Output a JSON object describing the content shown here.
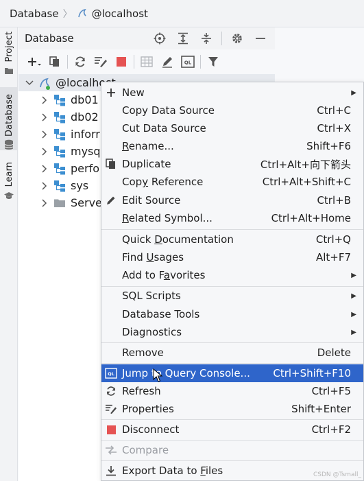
{
  "breadcrumb": {
    "root": "Database",
    "host": "@localhost"
  },
  "strip": {
    "project": "Project",
    "database": "Database",
    "learn": "Learn"
  },
  "tool_window": {
    "title": "Database"
  },
  "tree": {
    "root": {
      "label": "@localhost"
    },
    "items": [
      {
        "label": "db01",
        "kind": "schema"
      },
      {
        "label": "db02",
        "kind": "schema"
      },
      {
        "label": "inforr",
        "kind": "schema"
      },
      {
        "label": "mysq",
        "kind": "schema"
      },
      {
        "label": "perfo",
        "kind": "schema"
      },
      {
        "label": "sys",
        "kind": "schema"
      },
      {
        "label": "Serve",
        "kind": "folder"
      }
    ]
  },
  "menu": {
    "new": {
      "label": "New"
    },
    "copy_source": {
      "label": "Copy Data Source",
      "shortcut": "Ctrl+C"
    },
    "cut_source": {
      "label": "Cut Data Source",
      "shortcut": "Ctrl+X"
    },
    "rename": {
      "label_u": "R",
      "label": "ename...",
      "shortcut": "Shift+F6"
    },
    "duplicate": {
      "label": "Duplicate",
      "shortcut": "Ctrl+Alt+向下箭头"
    },
    "copy_reference": {
      "label_a": "Cop",
      "label_u": "y",
      "label_b": " Reference",
      "shortcut": "Ctrl+Alt+Shift+C"
    },
    "edit_source": {
      "label": "Edit Source",
      "shortcut": "Ctrl+B"
    },
    "related_symbol": {
      "label_u": "R",
      "label": "elated Symbol...",
      "shortcut": "Ctrl+Alt+Home"
    },
    "quick_doc": {
      "label_a": "Quick ",
      "label_u": "D",
      "label_b": "ocumentation",
      "shortcut": "Ctrl+Q"
    },
    "find_usages": {
      "label_a": "Find ",
      "label_u": "U",
      "label_b": "sages",
      "shortcut": "Alt+F7"
    },
    "add_favorites": {
      "label_a": "Add to F",
      "label_u": "a",
      "label_b": "vorites"
    },
    "sql_scripts": {
      "label": "SQL Scripts"
    },
    "database_tools": {
      "label": "Database Tools"
    },
    "diagnostics": {
      "label": "Diagnostics"
    },
    "remove": {
      "label": "Remove",
      "shortcut": "Delete"
    },
    "jump_console": {
      "label": "Jump to Query Console...",
      "shortcut": "Ctrl+Shift+F10"
    },
    "refresh": {
      "label": "Refresh",
      "shortcut": "Ctrl+F5"
    },
    "properties": {
      "label": "Properties",
      "shortcut": "Shift+Enter"
    },
    "disconnect": {
      "label": "Disconnect",
      "shortcut": "Ctrl+F2"
    },
    "compare": {
      "label": "Compare"
    },
    "export": {
      "label_a": "Export Data to ",
      "label_u": "F",
      "label_b": "iles"
    }
  },
  "watermark": "CSDN @Tsmall_",
  "colors": {
    "accent": "#2f65ca",
    "stop": "#e55353",
    "schema": "#3d8fd1"
  }
}
